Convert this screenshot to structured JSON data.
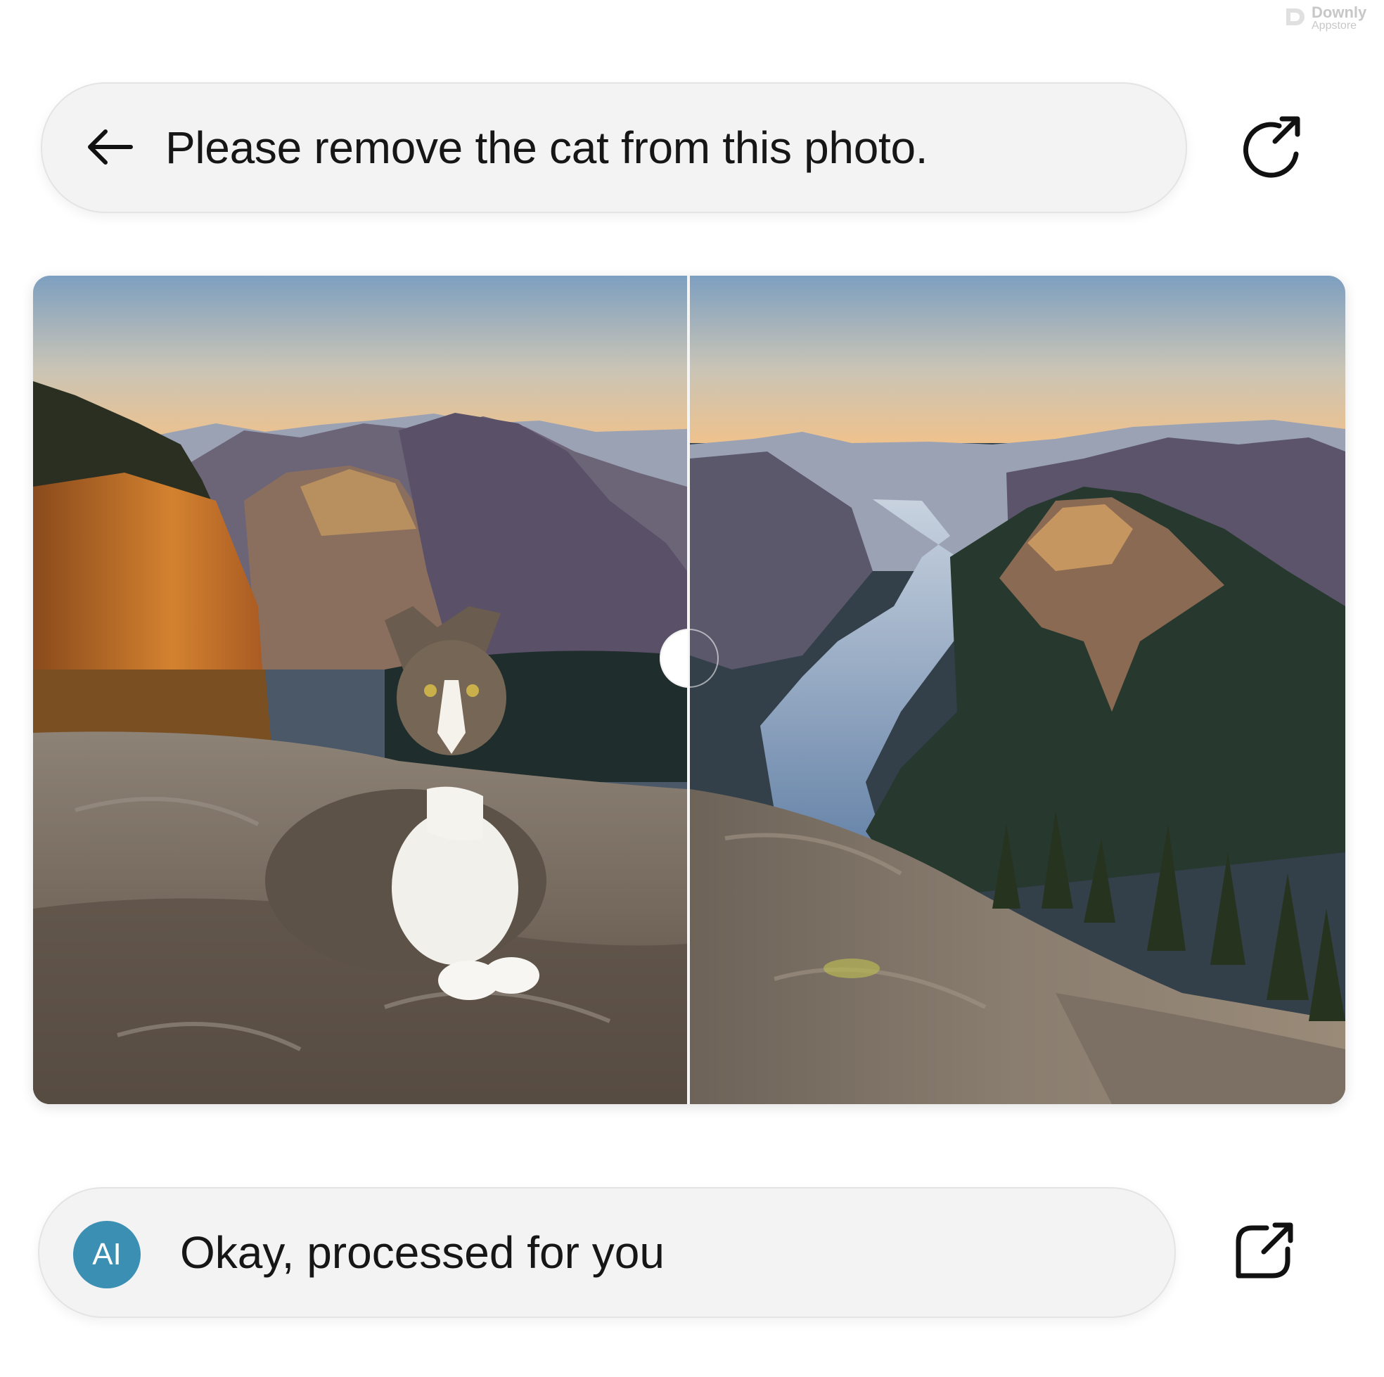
{
  "watermark": {
    "line1": "Downly",
    "line2": "Appstore"
  },
  "prompt": {
    "text": "Please remove the cat from this photo."
  },
  "reply": {
    "avatar_label": "AI",
    "text": "Okay, processed for you"
  },
  "icons": {
    "back": "arrow-left-icon",
    "refresh": "refresh-external-icon",
    "share": "share-external-icon",
    "avatar": "ai-avatar"
  },
  "comparison": {
    "before": "photo-with-cat",
    "after": "photo-cat-removed"
  },
  "colors": {
    "bubble_bg": "#f3f3f3",
    "avatar_bg": "#3a8fb3",
    "sky_top": "#7d9fc0",
    "sky_horizon": "#efc28c"
  }
}
